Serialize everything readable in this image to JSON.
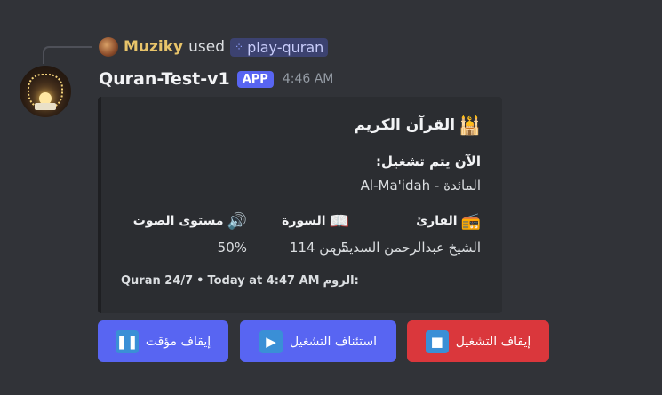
{
  "reference": {
    "username": "Muziky",
    "used_text": "used",
    "command": "play-quran"
  },
  "message": {
    "bot_name": "Quran-Test-v1",
    "badge": "APP",
    "time": "4:46 AM"
  },
  "embed": {
    "title": "القرآن الكريم",
    "now_playing_label": "الآن يتم تشغيل:",
    "now_playing_value": "Al-Ma'idah - المائدة",
    "fields": {
      "reciter": {
        "name": "القارئ",
        "value": "الشيخ عبدالرحمن السديس",
        "icon": "radio-icon"
      },
      "surah": {
        "name": "السورة",
        "value": "5 من 114",
        "icon": "book-icon"
      },
      "volume": {
        "name": "مستوى الصوت",
        "value": "50%",
        "icon": "speaker-icon"
      }
    },
    "footer_room_label": "الروم:",
    "footer_room": "Quran 24/7",
    "footer_sep": "•",
    "footer_time": "Today at 4:47 AM"
  },
  "buttons": {
    "pause": "إيقاف مؤقت",
    "resume": "استئناف التشغيل",
    "stop": "إيقاف التشغيل"
  },
  "colors": {
    "background": "#313338",
    "embed": "#2b2d31",
    "blurple": "#5865f2",
    "danger": "#da373c",
    "username": "#e8c46a"
  }
}
